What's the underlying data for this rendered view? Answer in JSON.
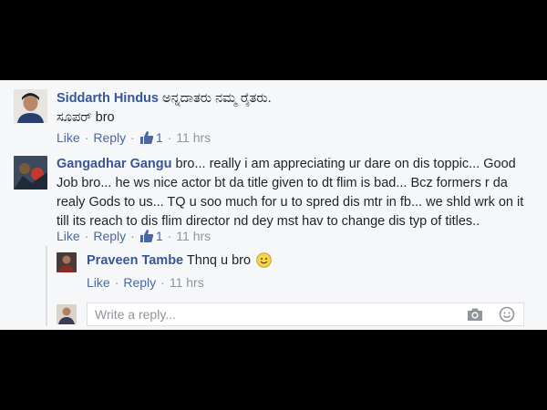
{
  "comments": [
    {
      "author": "Siddarth Hindus",
      "text_inline": "ಅನ್ನದಾತರು ನಮ್ಮ ರೈತರು.",
      "text_line2": "ಸೂಪರ್ bro",
      "like": "Like",
      "reply": "Reply",
      "like_count": "1",
      "time": "11 hrs"
    },
    {
      "author": "Gangadhar Gangu",
      "text_line1": "bro... really i am appreciating ur dare on dis toppic... Good",
      "text_line2": "Job bro... he ws nice actor bt da title given to dt flim is bad... Bcz formers r da",
      "text_line3": "realy Gods to us... TQ u soo much for u to spred dis mtr in fb... we shld wrk on it",
      "text_line4": "till its reach to dis flim director nd dey mst hav to change dis typ of titles..",
      "like": "Like",
      "reply": "Reply",
      "like_count": "1",
      "time": "11 hrs",
      "reply_item": {
        "author": "Praveen Tambe",
        "text": "Thnq u bro",
        "like": "Like",
        "reply": "Reply",
        "time": "11 hrs"
      }
    }
  ],
  "reply_box": {
    "placeholder": "Write a reply..."
  },
  "colors": {
    "name": "#365899",
    "link": "#4b67a1",
    "muted": "#90949c",
    "panel_bg": "#f6f7f9"
  }
}
